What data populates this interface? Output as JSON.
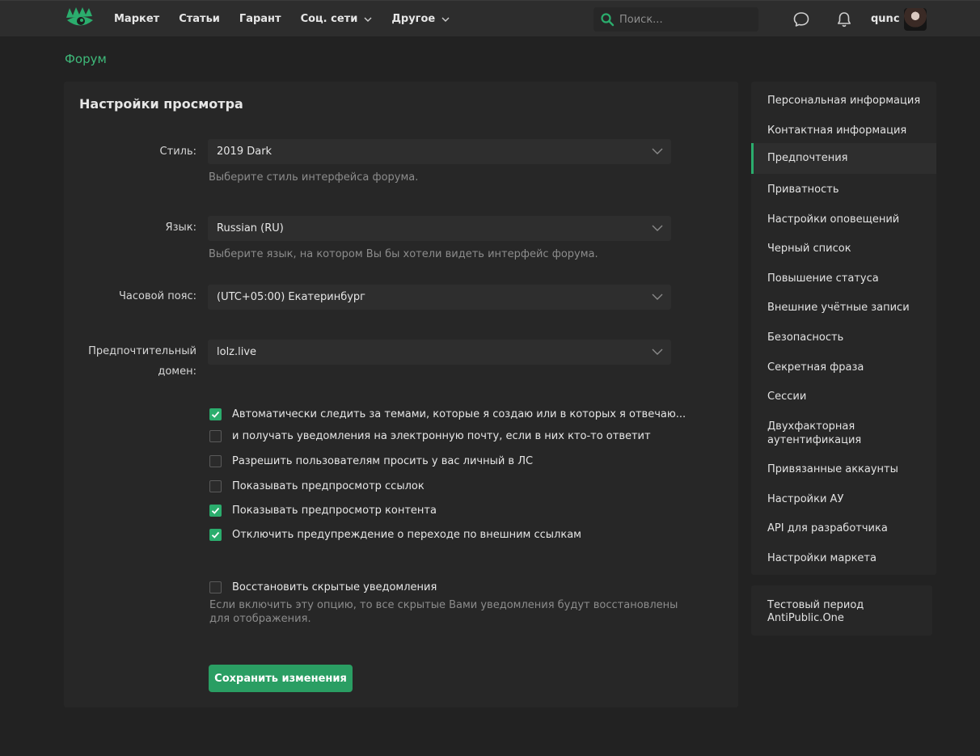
{
  "header": {
    "nav": [
      {
        "label": "Маркет",
        "dropdown": false
      },
      {
        "label": "Статьи",
        "dropdown": false
      },
      {
        "label": "Гарант",
        "dropdown": false
      },
      {
        "label": "Соц. сети",
        "dropdown": true
      },
      {
        "label": "Другое",
        "dropdown": true
      }
    ],
    "search_placeholder": "Поиск...",
    "username": "qunc"
  },
  "breadcrumb": "Форум",
  "settings": {
    "title": "Настройки просмотра",
    "style": {
      "label": "Стиль:",
      "value": "2019 Dark",
      "hint": "Выберите стиль интерфейса форума."
    },
    "language": {
      "label": "Язык:",
      "value": "Russian (RU)",
      "hint": "Выберите язык, на котором Вы бы хотели видеть интерфейс форума."
    },
    "timezone": {
      "label": "Часовой пояс:",
      "value": "(UTC+05:00) Екатеринбург"
    },
    "domain": {
      "label_line1": "Предпочтительный",
      "label_line2": "домен:",
      "value": "lolz.live"
    },
    "checkboxes": [
      {
        "label": "Автоматически следить за темами, которые я создаю или в которых я отвечаю...",
        "checked": true
      },
      {
        "label": "и получать уведомления на электронную почту, если в них кто-то ответит",
        "checked": false
      },
      {
        "label": "Разрешить пользователям просить у вас личный в ЛС",
        "checked": false
      },
      {
        "label": "Показывать предпросмотр ссылок",
        "checked": false
      },
      {
        "label": "Показывать предпросмотр контента",
        "checked": true
      },
      {
        "label": "Отключить предупреждение о переходе по внешним ссылкам",
        "checked": true
      }
    ],
    "restore": {
      "label": "Восстановить скрытые уведомления",
      "checked": false,
      "hint": "Если включить эту опцию, то все скрытые Вами уведомления будут восстановлены для отображения."
    },
    "save_label": "Сохранить изменения"
  },
  "sidebar": {
    "items": [
      {
        "label": "Персональная информация"
      },
      {
        "label": "Контактная информация"
      },
      {
        "label": "Предпочтения",
        "active": true
      },
      {
        "label": "Приватность"
      },
      {
        "label": "Настройки оповещений"
      },
      {
        "label": "Черный список"
      },
      {
        "label": "Повышение статуса"
      },
      {
        "label": "Внешние учётные записи"
      },
      {
        "label": "Безопасность"
      },
      {
        "label": "Секретная фраза"
      },
      {
        "label": "Сессии"
      },
      {
        "label": "Двухфакторная аутентификация"
      },
      {
        "label": "Привязанные аккаунты"
      },
      {
        "label": "Настройки АУ"
      },
      {
        "label": "API для разработчика"
      },
      {
        "label": "Настройки маркета"
      }
    ],
    "promo": "Тестовый период AntiPublic.One"
  },
  "colors": {
    "accent": "#2bad6d",
    "background": "#222222",
    "panel": "#272727"
  }
}
